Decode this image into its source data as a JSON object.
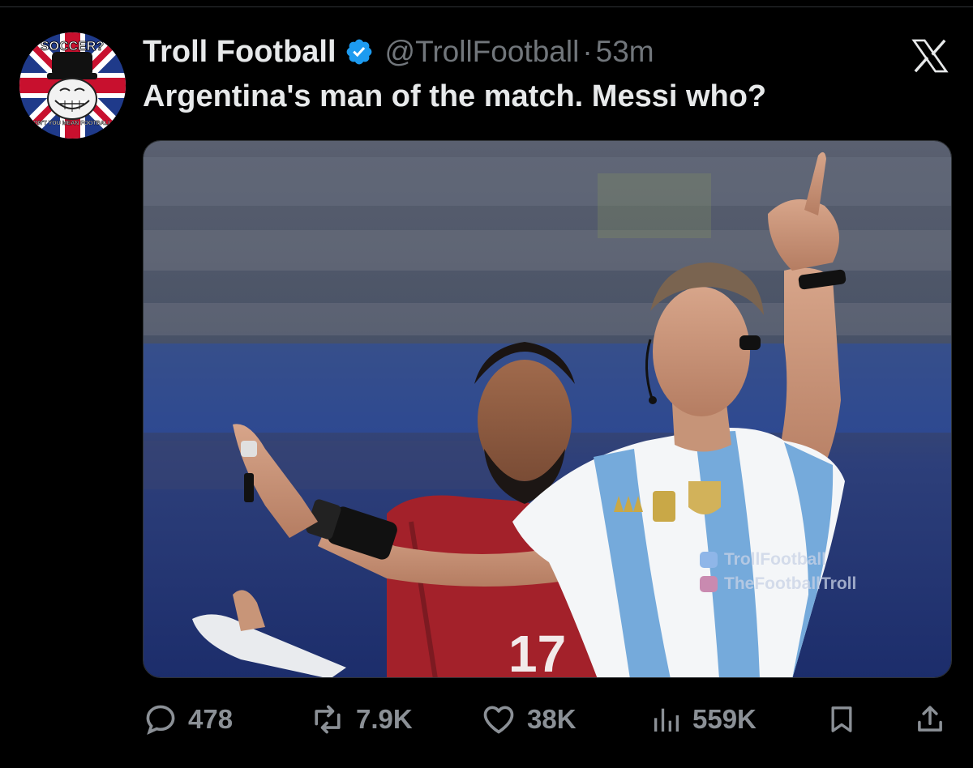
{
  "author": {
    "display_name": "Troll Football",
    "handle": "@TrollFootball",
    "separator": "·",
    "time": "53m",
    "verified": true,
    "avatar_icon": "troll-face-union-jack-avatar",
    "avatar_text_top": "SOCCER?",
    "avatar_text_bottom": "DON'T YOU MEAN FOOTBALL?"
  },
  "platform_logo": "x-logo",
  "tweet": {
    "text": "Argentina's man of the match. Messi who?"
  },
  "media": {
    "type": "photo",
    "description_icon": "referee-photo",
    "shirt_number": "17",
    "watermark": {
      "line1": "TrollFootball",
      "line1_icon": "twitter-bird-icon",
      "line2": "TheFootballTroll",
      "line2_icon": "instagram-icon"
    }
  },
  "actions": {
    "replies": "478",
    "reposts": "7.9K",
    "likes": "38K",
    "views": "559K"
  },
  "colors": {
    "background": "#000000",
    "text_primary": "#e7e9ea",
    "text_secondary": "#71767b",
    "verified_blue": "#1d9bf0",
    "argentina_blue": "#75aadb"
  }
}
